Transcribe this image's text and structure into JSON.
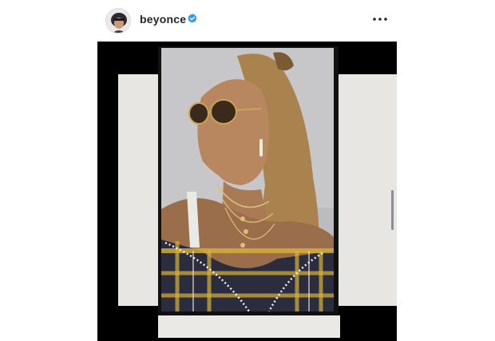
{
  "post": {
    "author": {
      "username": "beyonce",
      "verified": true,
      "avatar_icon": "profile-avatar",
      "verified_icon": "verified-badge-icon",
      "verified_color": "#3897f0"
    },
    "more_icon": "more-options-icon",
    "media": {
      "type": "photo",
      "background_color": "#000000",
      "paper_color": "#e8e6e2"
    }
  }
}
